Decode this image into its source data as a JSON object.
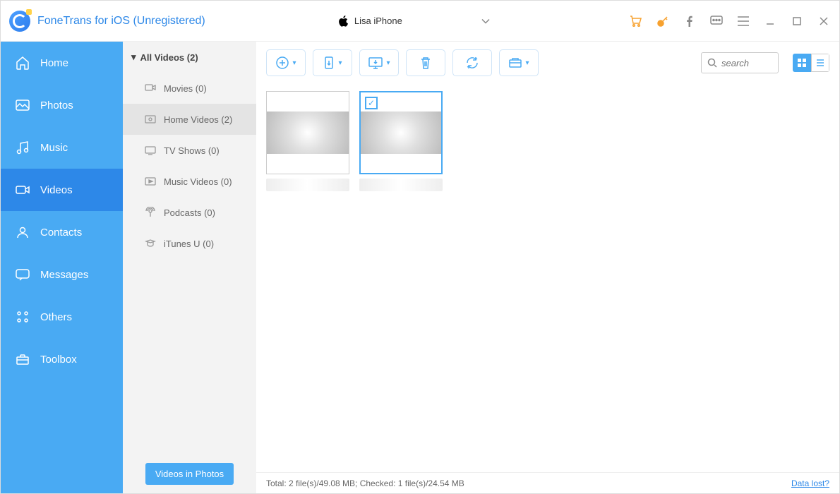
{
  "app": {
    "title": "FoneTrans for iOS (Unregistered)",
    "device": "Lisa iPhone"
  },
  "titlebar_icons": {
    "cart": "cart-icon",
    "key": "key-icon",
    "facebook": "facebook-icon",
    "feedback": "feedback-icon",
    "menu": "menu-icon",
    "minimize": "minimize-icon",
    "maximize": "maximize-icon",
    "close": "close-icon"
  },
  "sidebar": {
    "items": [
      {
        "key": "home",
        "label": "Home"
      },
      {
        "key": "photos",
        "label": "Photos"
      },
      {
        "key": "music",
        "label": "Music"
      },
      {
        "key": "videos",
        "label": "Videos"
      },
      {
        "key": "contacts",
        "label": "Contacts"
      },
      {
        "key": "messages",
        "label": "Messages"
      },
      {
        "key": "others",
        "label": "Others"
      },
      {
        "key": "toolbox",
        "label": "Toolbox"
      }
    ],
    "active": "videos"
  },
  "subsidebar": {
    "header": "All Videos (2)",
    "items": [
      {
        "key": "movies",
        "label": "Movies (0)"
      },
      {
        "key": "homevideos",
        "label": "Home Videos (2)"
      },
      {
        "key": "tvshows",
        "label": "TV Shows (0)"
      },
      {
        "key": "musicvideos",
        "label": "Music Videos (0)"
      },
      {
        "key": "podcasts",
        "label": "Podcasts (0)"
      },
      {
        "key": "itunesu",
        "label": "iTunes U (0)"
      }
    ],
    "active": "homevideos",
    "footer_button": "Videos in Photos"
  },
  "toolbar": {
    "buttons": [
      "add",
      "export-device",
      "export-pc",
      "delete",
      "refresh",
      "folder"
    ],
    "search_placeholder": "search"
  },
  "content": {
    "thumbs": [
      {
        "selected": false
      },
      {
        "selected": true
      }
    ]
  },
  "statusbar": {
    "text": "Total: 2 file(s)/49.08 MB; Checked: 1 file(s)/24.54 MB",
    "link": "Data lost?"
  }
}
